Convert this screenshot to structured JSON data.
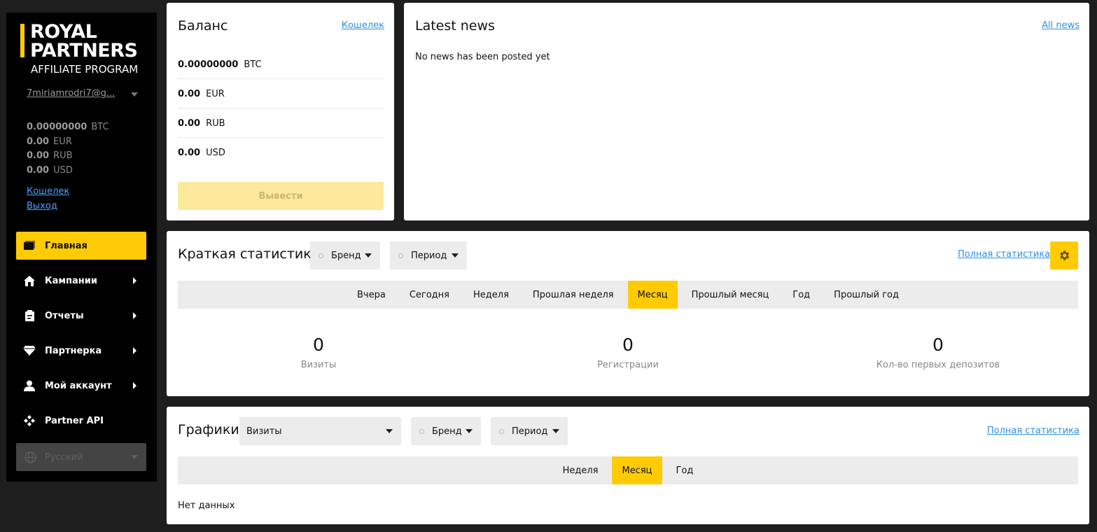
{
  "brand": {
    "line1": "ROYAL",
    "line2": "PARTNERS",
    "subtitle": "AFFILIATE PROGRAM",
    "accent": "#ffcb05"
  },
  "user": {
    "email": "7miriamrodri7@g..."
  },
  "sidebar_balance": [
    {
      "amount": "0.00000000",
      "currency": "BTC"
    },
    {
      "amount": "0.00",
      "currency": "EUR"
    },
    {
      "amount": "0.00",
      "currency": "RUB"
    },
    {
      "amount": "0.00",
      "currency": "USD"
    }
  ],
  "sidebar_links": {
    "wallet": "Кошелек",
    "logout": "Выход"
  },
  "nav": [
    {
      "label": "Главная",
      "icon": "folder-icon",
      "active": true
    },
    {
      "label": "Кампании",
      "icon": "home-icon"
    },
    {
      "label": "Отчеты",
      "icon": "clipboard-icon"
    },
    {
      "label": "Партнерка",
      "icon": "diamond-icon"
    },
    {
      "label": "Мой аккаунт",
      "icon": "user-icon"
    },
    {
      "label": "Partner API",
      "icon": "api-icon"
    }
  ],
  "language": {
    "selected": "Русский",
    "icon": "globe-icon"
  },
  "balance_card": {
    "title": "Баланс",
    "wallet_link": "Кошелек",
    "rows": [
      {
        "amount": "0.00000000",
        "currency": "BTC"
      },
      {
        "amount": "0.00",
        "currency": "EUR"
      },
      {
        "amount": "0.00",
        "currency": "RUB"
      },
      {
        "amount": "0.00",
        "currency": "USD"
      }
    ],
    "withdraw_label": "Вывести"
  },
  "news_card": {
    "title": "Latest news",
    "all_link": "All news",
    "empty_text": "No news has been posted yet"
  },
  "stats_card": {
    "title": "Краткая статистика",
    "brand_dropdown": "Бренд",
    "period_dropdown": "Период",
    "full_link": "Полная статистика",
    "tabs": [
      "Вчера",
      "Сегодня",
      "Неделя",
      "Прошлая неделя",
      "Месяц",
      "Прошлый месяц",
      "Год",
      "Прошлый год"
    ],
    "active_tab": "Месяц",
    "stats": [
      {
        "value": "0",
        "label": "Визиты"
      },
      {
        "value": "0",
        "label": "Регистрации"
      },
      {
        "value": "0",
        "label": "Кол-во первых депозитов"
      }
    ]
  },
  "charts_card": {
    "title": "Графики",
    "metric_dropdown": "Визиты",
    "brand_dropdown": "Бренд",
    "period_dropdown": "Период",
    "full_link": "Полная статистика",
    "tabs": [
      "Неделя",
      "Месяц",
      "Год"
    ],
    "active_tab": "Месяц",
    "empty_text": "Нет данных"
  }
}
